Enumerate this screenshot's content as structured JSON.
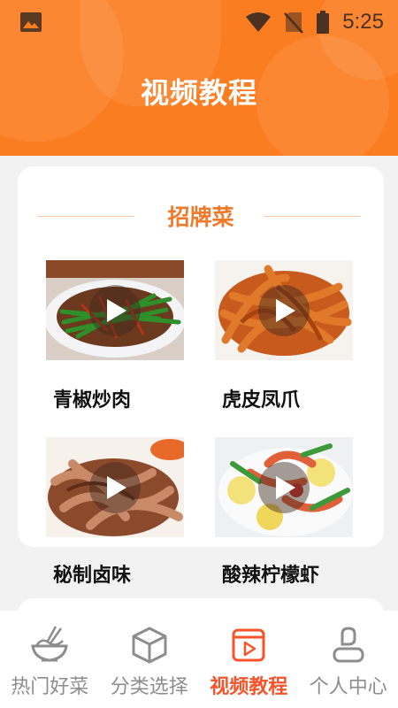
{
  "status_bar": {
    "time": "5:25",
    "icons": [
      "image-icon",
      "wifi-icon",
      "no-signal-icon",
      "battery-icon"
    ]
  },
  "header": {
    "title": "视频教程",
    "background_color": "#fb7d22"
  },
  "section": {
    "title": "招牌菜",
    "accent_color": "#f07a2a"
  },
  "dishes": [
    {
      "name": "青椒炒肉",
      "icon": "play-icon"
    },
    {
      "name": "虎皮凤爪",
      "icon": "play-icon"
    },
    {
      "name": "秘制卤味",
      "icon": "play-icon"
    },
    {
      "name": "酸辣柠檬虾",
      "icon": "play-icon"
    }
  ],
  "tabbar": {
    "active_color": "#f4552b",
    "items": [
      {
        "label": "热门好菜",
        "icon": "noodle-bowl-icon",
        "active": false
      },
      {
        "label": "分类选择",
        "icon": "cube-icon",
        "active": false
      },
      {
        "label": "视频教程",
        "icon": "video-play-icon",
        "active": true
      },
      {
        "label": "个人中心",
        "icon": "person-icon",
        "active": false
      }
    ]
  }
}
